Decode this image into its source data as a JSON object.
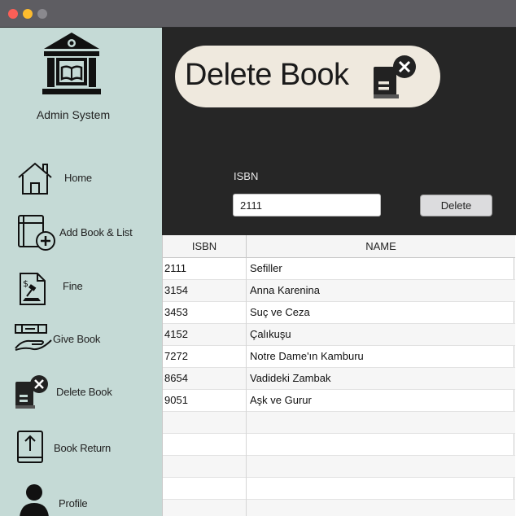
{
  "app": {
    "system_title": "Admin System"
  },
  "sidebar": {
    "items": [
      {
        "label": "Home",
        "icon": "home-icon"
      },
      {
        "label": "Add Book & List",
        "icon": "add-book-icon"
      },
      {
        "label": "Fine",
        "icon": "fine-document-icon"
      },
      {
        "label": "Give Book",
        "icon": "give-book-icon"
      },
      {
        "label": "Delete Book",
        "icon": "delete-book-icon"
      },
      {
        "label": "Book Return",
        "icon": "book-return-icon"
      },
      {
        "label": "Profile",
        "icon": "profile-icon"
      }
    ]
  },
  "header": {
    "title": "Delete Book",
    "icon": "delete-book-icon"
  },
  "form": {
    "isbn_label": "ISBN",
    "isbn_value": "2111",
    "delete_label": "Delete"
  },
  "table": {
    "columns": [
      "ISBN",
      "NAME"
    ],
    "rows": [
      {
        "isbn": "2111",
        "name": "Sefiller"
      },
      {
        "isbn": "3154",
        "name": "Anna Karenina"
      },
      {
        "isbn": "3453",
        "name": "Suç ve Ceza"
      },
      {
        "isbn": "4152",
        "name": "Çalıkuşu"
      },
      {
        "isbn": "7272",
        "name": "Notre Dame'ın Kamburu"
      },
      {
        "isbn": "8654",
        "name": "Vadideki Zambak"
      },
      {
        "isbn": "9051",
        "name": "Aşk ve Gurur"
      },
      {
        "isbn": "",
        "name": ""
      },
      {
        "isbn": "",
        "name": ""
      },
      {
        "isbn": "",
        "name": ""
      },
      {
        "isbn": "",
        "name": ""
      },
      {
        "isbn": "",
        "name": ""
      }
    ]
  },
  "colors": {
    "sidebar_bg": "#c5dad6",
    "main_dark_bg": "#262626",
    "header_pill_bg": "#efe9de"
  }
}
